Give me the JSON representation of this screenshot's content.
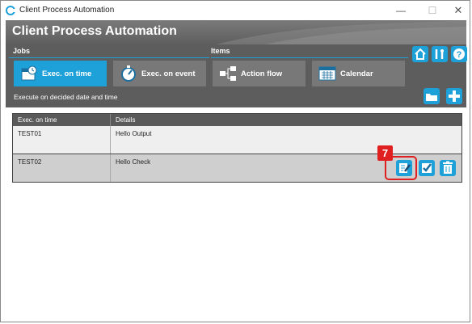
{
  "window": {
    "title": "Client Process Automation",
    "min": "—",
    "max": "☐",
    "close": "✕"
  },
  "header": {
    "title": "Client Process Automation"
  },
  "ribbon": {
    "jobs_label": "Jobs",
    "items_label": "Items",
    "buttons": {
      "exec_on_time": "Exec. on time",
      "exec_on_event": "Exec. on event",
      "action_flow": "Action flow",
      "calendar": "Calendar"
    },
    "status": "Execute on decided date and time",
    "accent": "#1ea0d8"
  },
  "table": {
    "headers": [
      "Exec. on time",
      "Details"
    ],
    "rows": [
      {
        "name": "TEST01",
        "details": "Hello Output"
      },
      {
        "name": "TEST02",
        "details": "Hello Check"
      }
    ]
  },
  "callout": {
    "number": "7",
    "color": "#e02020"
  }
}
